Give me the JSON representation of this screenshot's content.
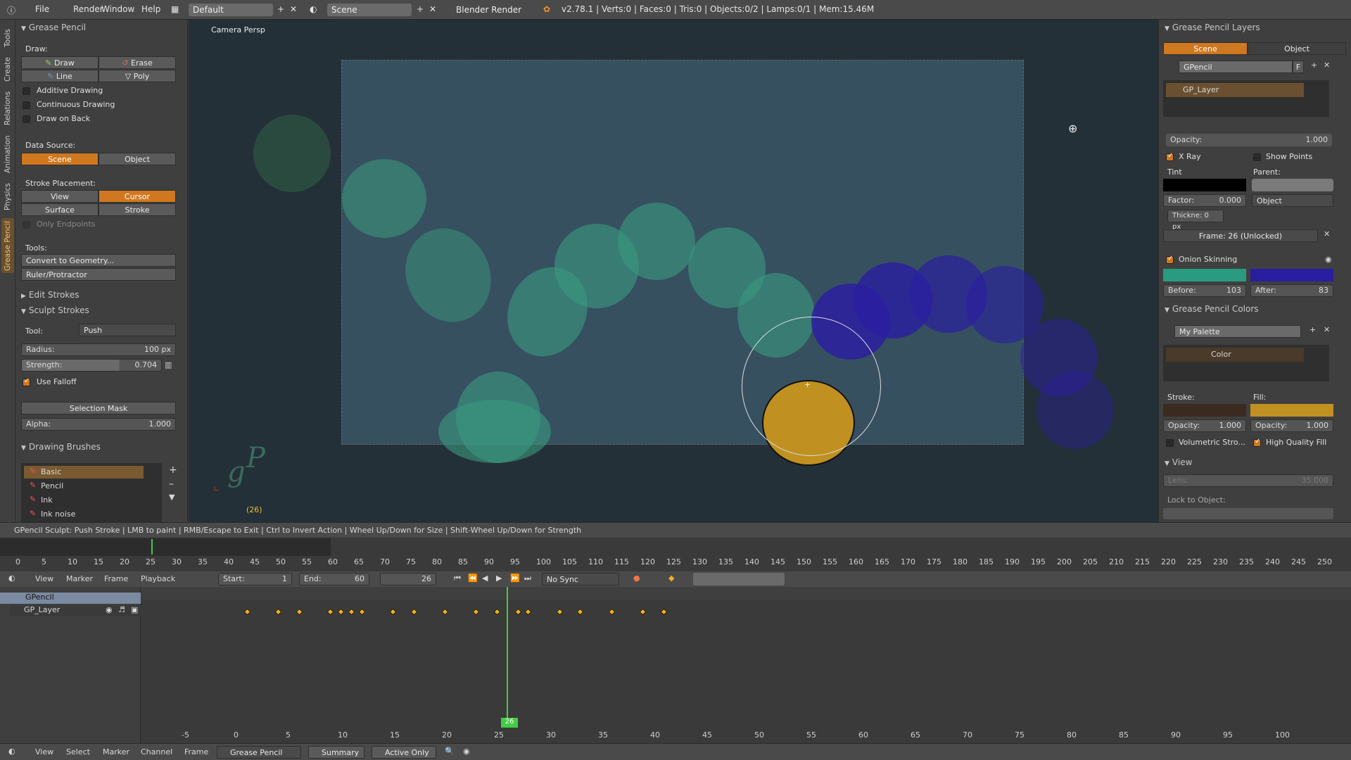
{
  "topbar": {
    "menu": [
      "File",
      "Render",
      "Window",
      "Help"
    ],
    "layout": "Default",
    "scene": "Scene",
    "engine": "Blender Render",
    "stats": "v2.78.1 | Verts:0 | Faces:0 | Tris:0 | Objects:0/2 | Lamps:0/1 | Mem:15.46M"
  },
  "tabs": [
    "Tools",
    "Create",
    "Relations",
    "Animation",
    "Physics",
    "Grease Pencil"
  ],
  "toolshelf": {
    "panel_title": "Grease Pencil",
    "draw_label": "Draw:",
    "draw": "Draw",
    "erase": "Erase",
    "line": "Line",
    "poly": "Poly",
    "additive": "Additive Drawing",
    "continuous": "Continuous Drawing",
    "drawback": "Draw on Back",
    "datasource_label": "Data Source:",
    "ds_scene": "Scene",
    "ds_object": "Object",
    "placement_label": "Stroke Placement:",
    "pl_view": "View",
    "pl_cursor": "Cursor",
    "pl_surface": "Surface",
    "pl_stroke": "Stroke",
    "only_endpoints": "Only Endpoints",
    "tools_label": "Tools:",
    "convert": "Convert to Geometry...",
    "ruler": "Ruler/Protractor",
    "edit_strokes": "Edit Strokes",
    "sculpt_strokes": "Sculpt Strokes",
    "tool_label": "Tool:",
    "tool_value": "Push",
    "radius_label": "Radius:",
    "radius_value": "100 px",
    "strength_label": "Strength:",
    "strength_value": "0.704",
    "use_falloff": "Use Falloff",
    "selection_mask": "Selection Mask",
    "alpha_label": "Alpha:",
    "alpha_value": "1.000",
    "drawing_brushes": "Drawing Brushes",
    "brushes": [
      "Basic",
      "Pencil",
      "Ink",
      "Ink noise"
    ]
  },
  "viewport": {
    "label": "Camera Persp",
    "frame": "(26)"
  },
  "props": {
    "layers_title": "Grease Pencil Layers",
    "tab_scene": "Scene",
    "tab_object": "Object",
    "gpencil": "GPencil",
    "f": "F",
    "layer": "GP_Layer",
    "opacity_label": "Opacity:",
    "opacity_value": "1.000",
    "xray": "X Ray",
    "show_points": "Show Points",
    "tint": "Tint",
    "parent": "Parent:",
    "factor_label": "Factor:",
    "factor_value": "0.000",
    "parent_type": "Object",
    "thickness": "Thickne: 0 px",
    "frame_status": "Frame: 26 (Unlocked)",
    "onion": "Onion Skinning",
    "before_label": "Before:",
    "before_value": "103",
    "after_label": "After:",
    "after_value": "83",
    "colors_title": "Grease Pencil Colors",
    "palette": "My Palette",
    "color_name": "Color",
    "stroke_label": "Stroke:",
    "fill_label": "Fill:",
    "stroke_op_label": "Opacity:",
    "stroke_op_value": "1.000",
    "fill_op_label": "Opacity:",
    "fill_op_value": "1.000",
    "volumetric": "Volumetric Stro...",
    "hq_fill": "High Quality Fill",
    "view_title": "View",
    "lens_label": "Lens:",
    "lens_value": "35.000",
    "lock_label": "Lock to Object:",
    "colors": {
      "onion_before": "#2a9a80",
      "onion_after": "#2a1ea0",
      "fill": "#c09020",
      "stroke": "#3a2a20",
      "tint": "#000000",
      "accent": "#d07820"
    }
  },
  "status": "GPencil Sculpt: Push Stroke | LMB to paint | RMB/Escape to Exit | Ctrl to Invert Action | Wheel Up/Down for Size | Shift-Wheel Up/Down for Strength",
  "timeline_ticks": [
    "0",
    "5",
    "10",
    "15",
    "20",
    "25",
    "30",
    "35",
    "40",
    "45",
    "50",
    "55",
    "60",
    "65",
    "70",
    "75",
    "80",
    "85",
    "90",
    "95",
    "100",
    "105",
    "110",
    "115",
    "120",
    "125",
    "130",
    "135",
    "140",
    "145",
    "150",
    "155",
    "160",
    "165",
    "170",
    "175",
    "180",
    "185",
    "190",
    "195",
    "200",
    "205",
    "210",
    "215",
    "220",
    "225",
    "230",
    "235",
    "240",
    "245",
    "250"
  ],
  "tl_header": {
    "menu": [
      "View",
      "Marker",
      "Frame",
      "Playback"
    ],
    "start_label": "Start:",
    "start_value": "1",
    "end_label": "End:",
    "end_value": "60",
    "current": "26",
    "sync": "No Sync"
  },
  "dopesheet": {
    "channels": [
      "GPencil",
      "GP_Layer"
    ],
    "current_frame": "26",
    "ticks": [
      "-5",
      "0",
      "5",
      "10",
      "15",
      "20",
      "25",
      "30",
      "35",
      "40",
      "45",
      "50",
      "55",
      "60",
      "65",
      "70",
      "75",
      "80",
      "85",
      "90",
      "95",
      "100"
    ],
    "keyframes": [
      1,
      4,
      6,
      9,
      10,
      11,
      12,
      15,
      17,
      20,
      23,
      25,
      27,
      28,
      31,
      33,
      36,
      39,
      41
    ]
  },
  "bottombar": {
    "menu": [
      "View",
      "Select",
      "Marker",
      "Channel",
      "Frame"
    ],
    "mode": "Grease Pencil",
    "summary": "Summary",
    "active_only": "Active Only"
  }
}
